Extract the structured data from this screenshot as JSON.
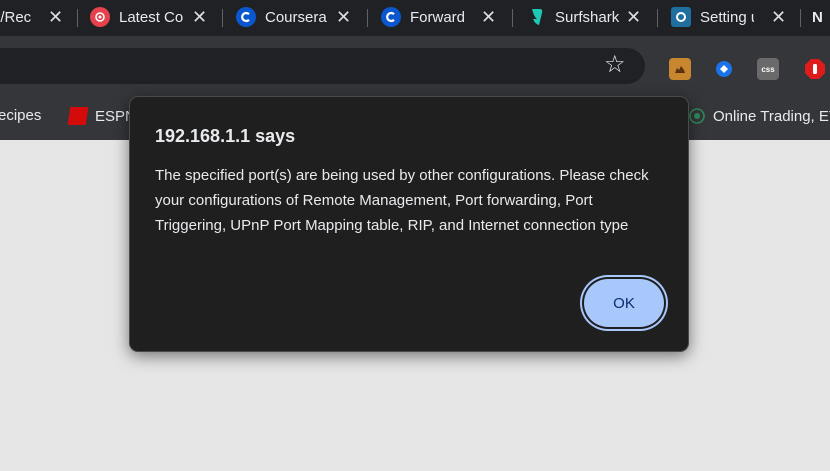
{
  "tabs": [
    {
      "title": "e/Rec",
      "favicon": "none"
    },
    {
      "title": "Latest Co",
      "favicon": "red-swirl-icon",
      "color": "#e5424d"
    },
    {
      "title": "Coursera",
      "favicon": "c-logo-icon",
      "color": "#0b57d0"
    },
    {
      "title": "Forward",
      "favicon": "c-logo-icon",
      "color": "#0b57d0"
    },
    {
      "title": "Surfshark",
      "favicon": "shark-icon",
      "color": "#1ec8b4"
    },
    {
      "title": "Setting u",
      "favicon": "o-logo-icon",
      "color": "#1f6f9e"
    },
    {
      "title": "N",
      "favicon": "none"
    }
  ],
  "bookmarks": [
    {
      "label": "ecipes"
    },
    {
      "label": "ESPN",
      "color": "#d50a0a"
    },
    {
      "label": "Online Trading, ET",
      "color": "#2e8b57"
    }
  ],
  "dialog": {
    "title": "192.168.1.1 says",
    "message": "The specified port(s) are being used by other configurations. Please check your configurations of Remote Management, Port forwarding, Port Triggering, UPnP Port Mapping table, RIP, and Internet connection type",
    "ok_label": "OK"
  },
  "colors": {
    "ok_bg": "#a8c7fa",
    "dialog_bg": "#1f1f1f",
    "page_bg": "#e6e6e6"
  }
}
